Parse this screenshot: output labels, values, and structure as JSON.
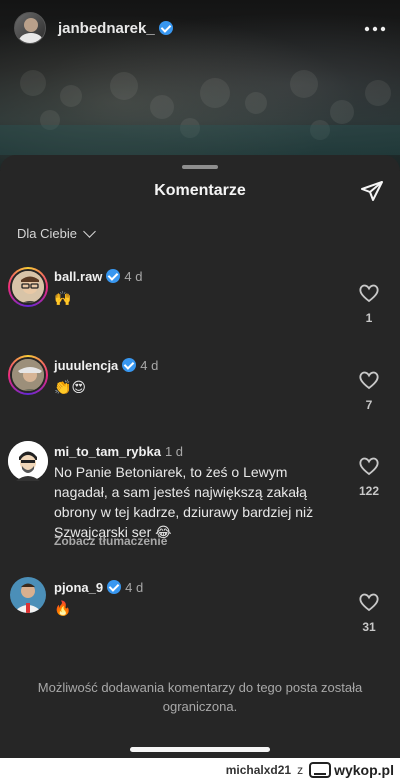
{
  "header": {
    "username": "janbednarek_"
  },
  "sheet": {
    "title": "Komentarze",
    "filter_label": "Dla Ciebie"
  },
  "comments": [
    {
      "user": "ball.raw",
      "verified": true,
      "time": "4 d",
      "text": "🙌",
      "likes": "1"
    },
    {
      "user": "juuulencja",
      "verified": true,
      "time": "4 d",
      "text": "👏😍",
      "likes": "7"
    },
    {
      "user": "mi_to_tam_rybka",
      "verified": false,
      "time": "1 d",
      "text": "No Panie Betoniarek, to żeś o Lewym nagadał, a sam jesteś największą zakałą obrony w tej kadrze, dziurawy bardziej niż Szwajcarski ser 😂",
      "translate": "Zobacz tłumaczenie",
      "likes": "122"
    },
    {
      "user": "pjona_9",
      "verified": true,
      "time": "4 d",
      "text": "🔥",
      "likes": "31"
    }
  ],
  "restricted_notice": "Możliwość dodawania komentarzy do tego posta została ograniczona.",
  "watermark": {
    "user": "michalxd21",
    "z": "z",
    "site": "wykop.pl"
  },
  "colors": {
    "sheet_bg": "#262626",
    "verified": "#3897f0",
    "muted_text": "#a8a8a8"
  },
  "icons": [
    "more-icon",
    "send-icon",
    "chevron-down-icon",
    "heart-icon",
    "verified-icon",
    "wykop-logo-icon"
  ]
}
